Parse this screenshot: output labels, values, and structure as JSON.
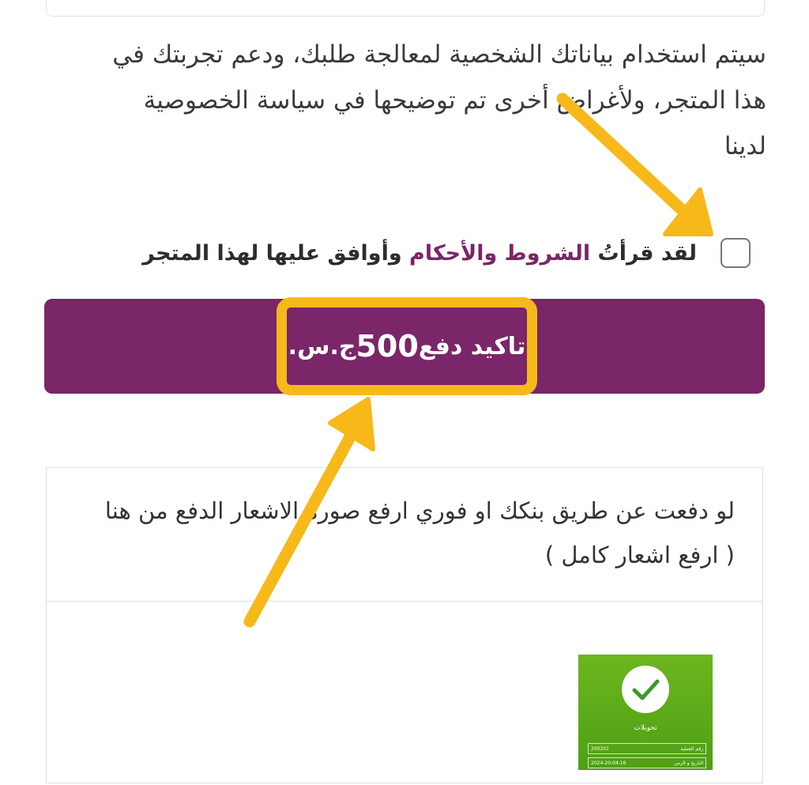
{
  "privacy_notice": "سيتم استخدام بياناتك الشخصية لمعالجة طلبك، ودعم تجربتك في هذا المتجر، ولأغراض أخرى تم توضيحها في سياسة الخصوصية لدينا",
  "terms": {
    "prefix": "لقد قرأتُ ",
    "link": "الشروط والأحكام",
    "suffix": " وأوافق عليها لهذا المتجر",
    "checked": false
  },
  "pay_button": {
    "prefix": "تاكيد دفع ",
    "amount": "500",
    "currency": "ج.س."
  },
  "upload": {
    "instruction": "لو دفعت عن طريق بنكك او فوري ارفع صورة الاشعار الدفع من هنا ( ارفع اشعار كامل )"
  },
  "receipt": {
    "title": "تحويلات",
    "rows": [
      {
        "label": "رقم العملية",
        "value": "200201"
      },
      {
        "label": "التاريخ و الزمن",
        "value": "2024-20:04:16"
      }
    ]
  },
  "colors": {
    "accent": "#7a2668",
    "highlight": "#f7b81a",
    "receipt_green": "#5aa818"
  }
}
